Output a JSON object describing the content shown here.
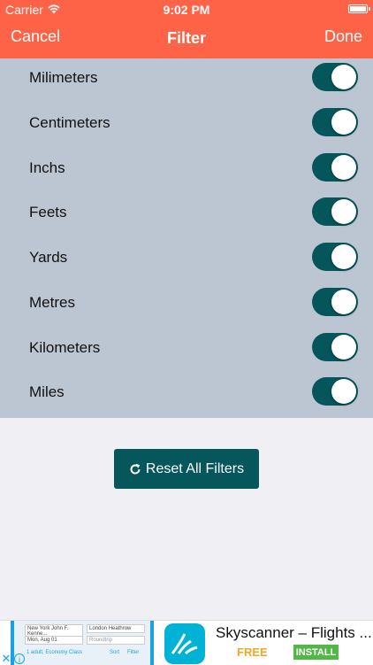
{
  "status_bar": {
    "carrier": "Carrier",
    "time": "9:02 PM"
  },
  "nav": {
    "cancel_label": "Cancel",
    "title": "Filter",
    "done_label": "Done"
  },
  "filters": [
    {
      "label": "Milimeters",
      "enabled": true
    },
    {
      "label": "Centimeters",
      "enabled": true
    },
    {
      "label": "Inchs",
      "enabled": true
    },
    {
      "label": "Feets",
      "enabled": true
    },
    {
      "label": "Yards",
      "enabled": true
    },
    {
      "label": "Metres",
      "enabled": true
    },
    {
      "label": "Kilometers",
      "enabled": true
    },
    {
      "label": "Miles",
      "enabled": true
    }
  ],
  "reset_button": {
    "label": "Reset All Filters",
    "icon": "refresh-icon"
  },
  "ad": {
    "preview_from": "New York John F. Kenne...",
    "preview_to": "London Heathrow",
    "preview_date": "Mon, Aug 01",
    "preview_trip": "Roundtrip",
    "preview_class": "1 adult, Economy Class",
    "preview_sort": "Sort",
    "preview_filter": "Filter",
    "title": "Skyscanner – Flights ...",
    "price": "FREE",
    "install_label": "INSTALL"
  },
  "colors": {
    "header": "#ff6347",
    "list_background": "#bcc6d3",
    "toggle_on": "#04565a",
    "reset_button": "#05575b",
    "ad_free": "#f5a623",
    "ad_install": "#53b748"
  }
}
